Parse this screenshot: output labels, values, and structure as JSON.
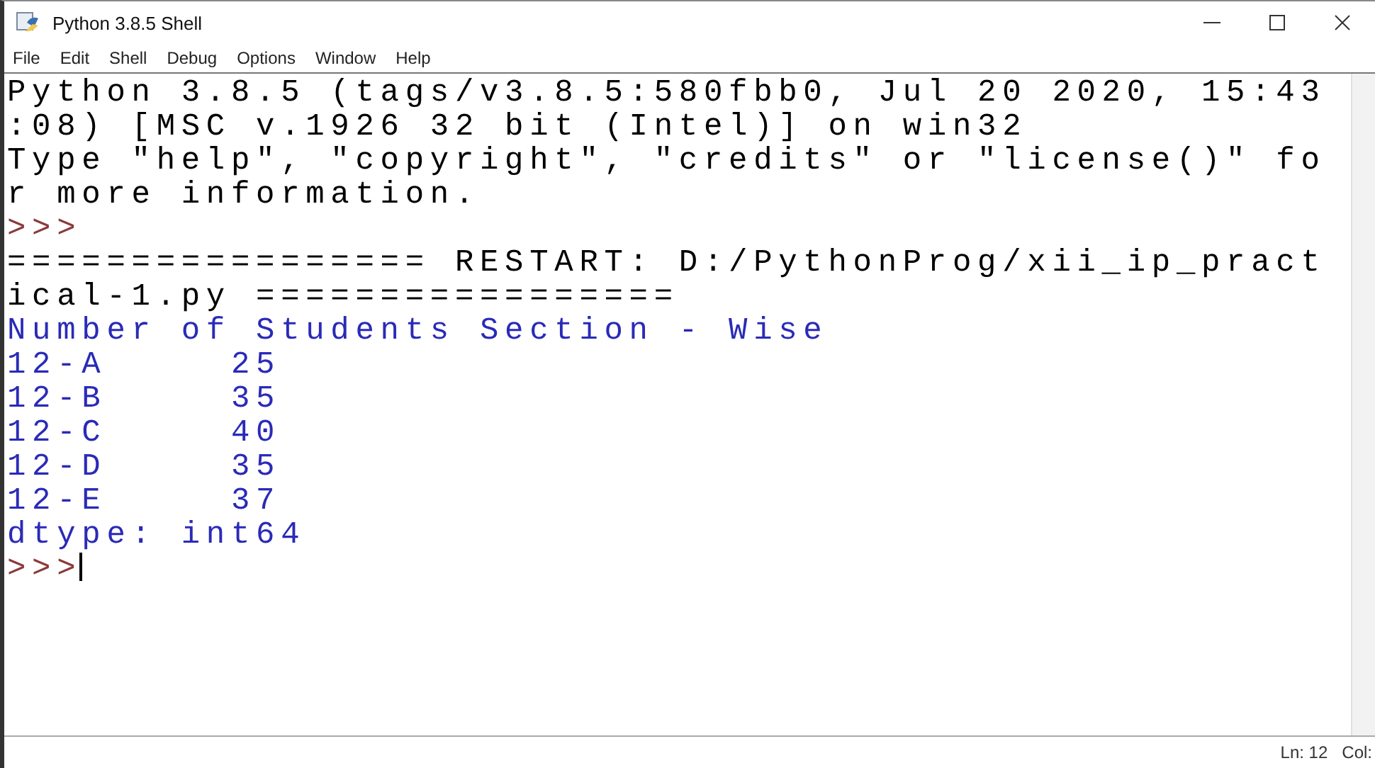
{
  "window": {
    "title": "Python 3.8.5 Shell"
  },
  "menu": [
    {
      "label": "File"
    },
    {
      "label": "Edit"
    },
    {
      "label": "Shell"
    },
    {
      "label": "Debug"
    },
    {
      "label": "Options"
    },
    {
      "label": "Window"
    },
    {
      "label": "Help"
    }
  ],
  "shell_lines": [
    {
      "kind": "stdout",
      "text": "Python 3.8.5 (tags/v3.8.5:580fbb0, Jul 20 2020, 15:43"
    },
    {
      "kind": "stdout",
      "text": ":08) [MSC v.1926 32 bit (Intel)] on win32"
    },
    {
      "kind": "stdout",
      "text": "Type \"help\", \"copyright\", \"credits\" or \"license()\" fo"
    },
    {
      "kind": "stdout",
      "text": "r more information."
    },
    {
      "kind": "prompt",
      "text": ">>>"
    },
    {
      "kind": "stdout",
      "text": "================= RESTART: D:/PythonProg/xii_ip_pract"
    },
    {
      "kind": "stdout",
      "text": "ical-1.py ================="
    },
    {
      "kind": "output",
      "text": "Number of Students Section - Wise"
    },
    {
      "kind": "output",
      "text": "12-A     25"
    },
    {
      "kind": "output",
      "text": "12-B     35"
    },
    {
      "kind": "output",
      "text": "12-C     40"
    },
    {
      "kind": "output",
      "text": "12-D     35"
    },
    {
      "kind": "output",
      "text": "12-E     37"
    },
    {
      "kind": "output",
      "text": "dtype: int64"
    },
    {
      "kind": "prompt",
      "text": ">>>",
      "cursor": true
    }
  ],
  "status_bar": {
    "line": "Ln: 12",
    "col": "Col:"
  }
}
